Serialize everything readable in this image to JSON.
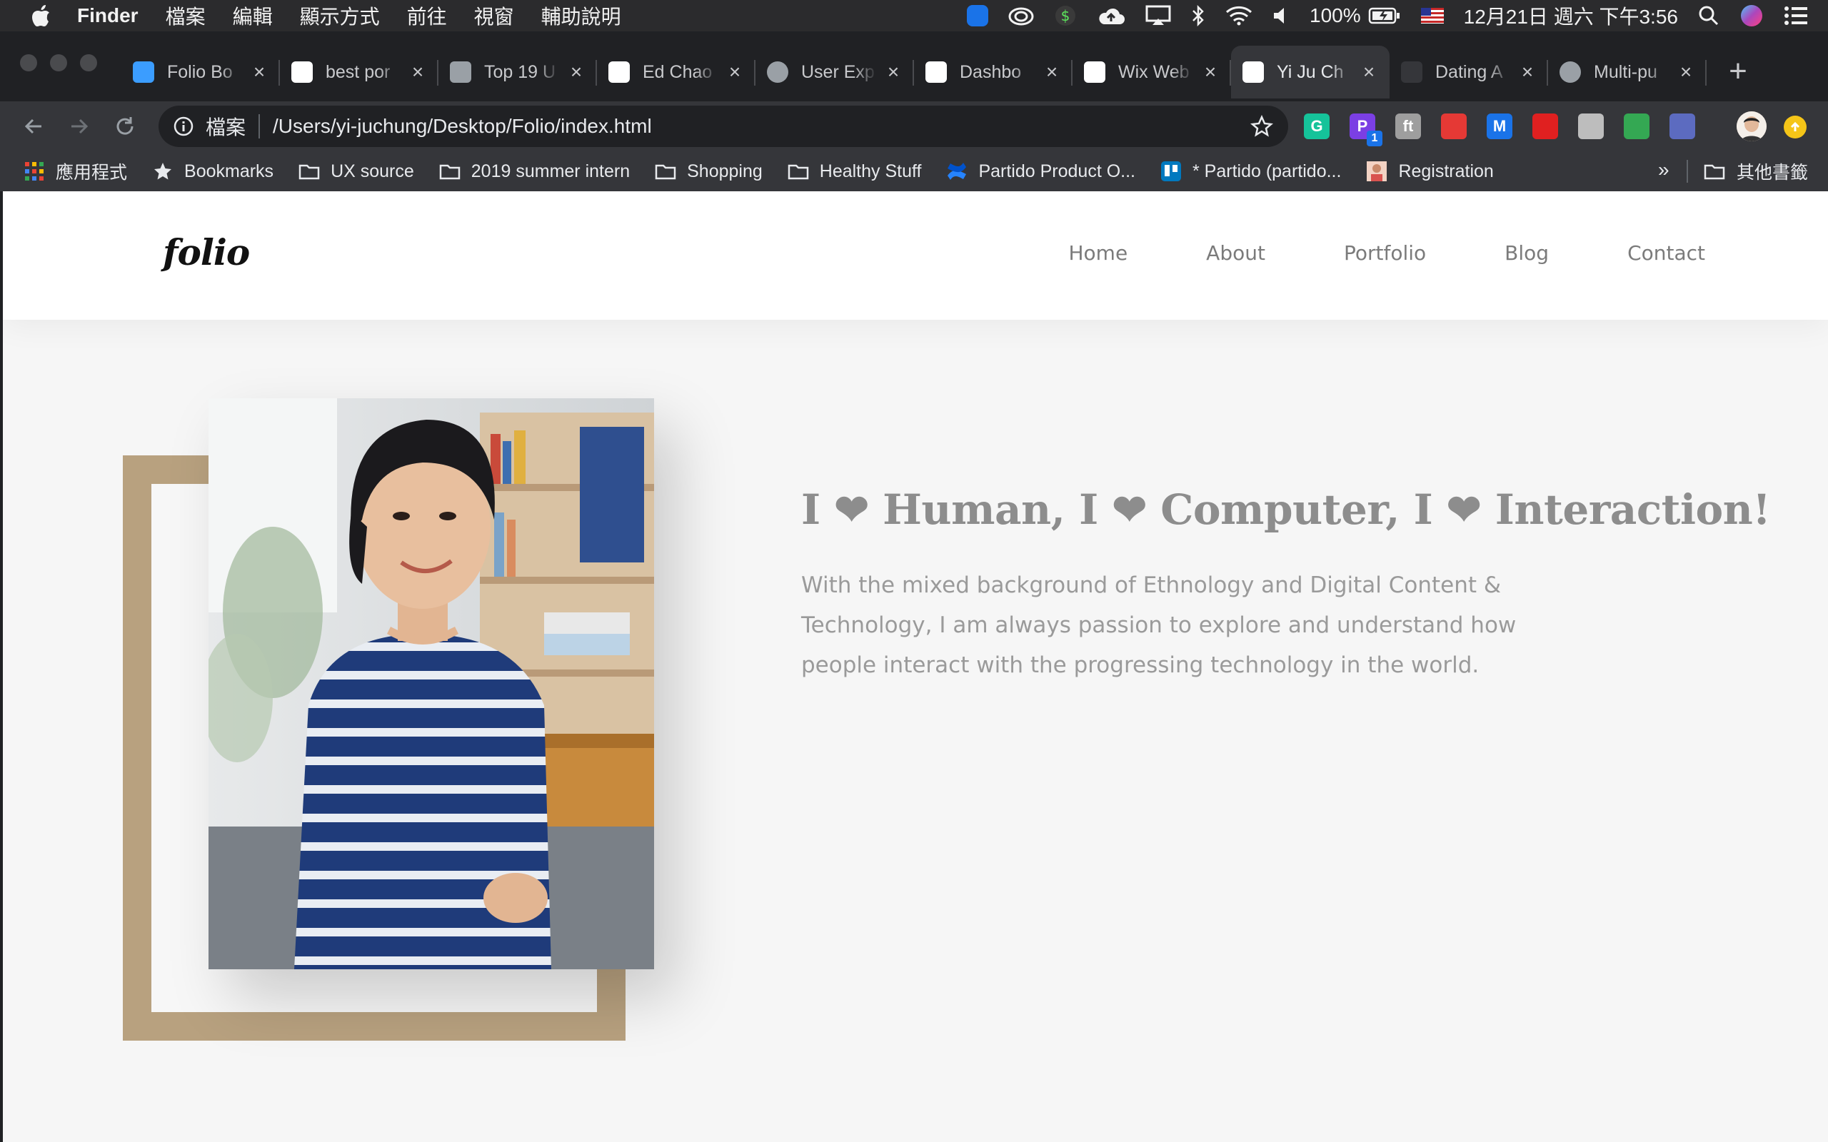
{
  "menubar": {
    "app_name": "Finder",
    "menus": [
      "檔案",
      "編輯",
      "顯示方式",
      "前往",
      "視窗",
      "輔助說明"
    ],
    "battery": "100%",
    "datetime": "12月21日 週六 下午3:56"
  },
  "browser": {
    "tabs": [
      {
        "title": "Folio Bo",
        "icon": "folio-bookmark-icon",
        "color": "#3b9dff",
        "active": false
      },
      {
        "title": "best por",
        "icon": "google-icon",
        "color": "#ffffff",
        "active": false
      },
      {
        "title": "Top 19 U",
        "icon": "document-icon",
        "color": "#9aa0a6",
        "active": false
      },
      {
        "title": "Ed Chao",
        "icon": "e-logo-icon",
        "color": "#ffffff",
        "active": false
      },
      {
        "title": "User Exp",
        "icon": "globe-icon",
        "color": "#9aa0a6",
        "active": false
      },
      {
        "title": "Dashbo",
        "icon": "wix-icon",
        "color": "#ffffff",
        "active": false
      },
      {
        "title": "Wix Web",
        "icon": "wix-icon",
        "color": "#ffffff",
        "active": false
      },
      {
        "title": "Yi Ju Ch",
        "icon": "f-logo-icon",
        "color": "#ffffff",
        "active": true
      },
      {
        "title": "Dating A",
        "icon": "blank-icon",
        "color": "#35363a",
        "active": false
      },
      {
        "title": "Multi-pu",
        "icon": "globe-icon",
        "color": "#9aa0a6",
        "active": false
      }
    ],
    "address": {
      "scheme_label": "檔案",
      "url": "/Users/yi-juchung/Desktop/Folio/index.html"
    },
    "extensions": [
      {
        "name": "grammarly-icon",
        "color": "#15c39a",
        "label": "G"
      },
      {
        "name": "p-extension-icon",
        "color": "#7b3fe4",
        "label": "P"
      },
      {
        "name": "font-extension-icon",
        "color": "#9e9e9e",
        "label": "ft"
      },
      {
        "name": "color-picker-icon",
        "color": "#e53935",
        "label": ""
      },
      {
        "name": "m-extension-icon",
        "color": "#1a73e8",
        "label": "M"
      },
      {
        "name": "adblock-icon",
        "color": "#e02020",
        "label": ""
      },
      {
        "name": "camera-icon",
        "color": "#bdbdbd",
        "label": ""
      },
      {
        "name": "download-icon",
        "color": "#34a853",
        "label": ""
      },
      {
        "name": "rocket-icon",
        "color": "#5c6bc0",
        "label": ""
      }
    ],
    "extension_badge": "1",
    "bookmarks": [
      {
        "label": "應用程式",
        "icon": "apps-grid-icon"
      },
      {
        "label": "Bookmarks",
        "icon": "star-icon"
      },
      {
        "label": "UX source",
        "icon": "folder-icon"
      },
      {
        "label": "2019 summer intern",
        "icon": "folder-icon"
      },
      {
        "label": "Shopping",
        "icon": "folder-icon"
      },
      {
        "label": "Healthy Stuff",
        "icon": "folder-icon"
      },
      {
        "label": "Partido Product O...",
        "icon": "confluence-icon"
      },
      {
        "label": "* Partido (partido...",
        "icon": "trello-icon"
      },
      {
        "label": "Registration",
        "icon": "registration-icon"
      }
    ],
    "bookmarks_overflow": "»",
    "other_bookmarks": "其他書籤"
  },
  "site": {
    "logo": "folio",
    "nav": [
      "Home",
      "About",
      "Portfolio",
      "Blog",
      "Contact"
    ],
    "headline": {
      "part1": "I ",
      "heart": "❤",
      "part2": " Human, I ",
      "part3": " Computer, I ",
      "part4": " Interaction!"
    },
    "lead": "With the mixed background of Ethnology and Digital Content & Technology, I am always passion to explore and understand how people interact with the progressing technology in the world.",
    "colors": {
      "frame": "#b8a17f",
      "text_gray": "#8d8d8d",
      "shirt_navy": "#1f3b7a"
    }
  }
}
